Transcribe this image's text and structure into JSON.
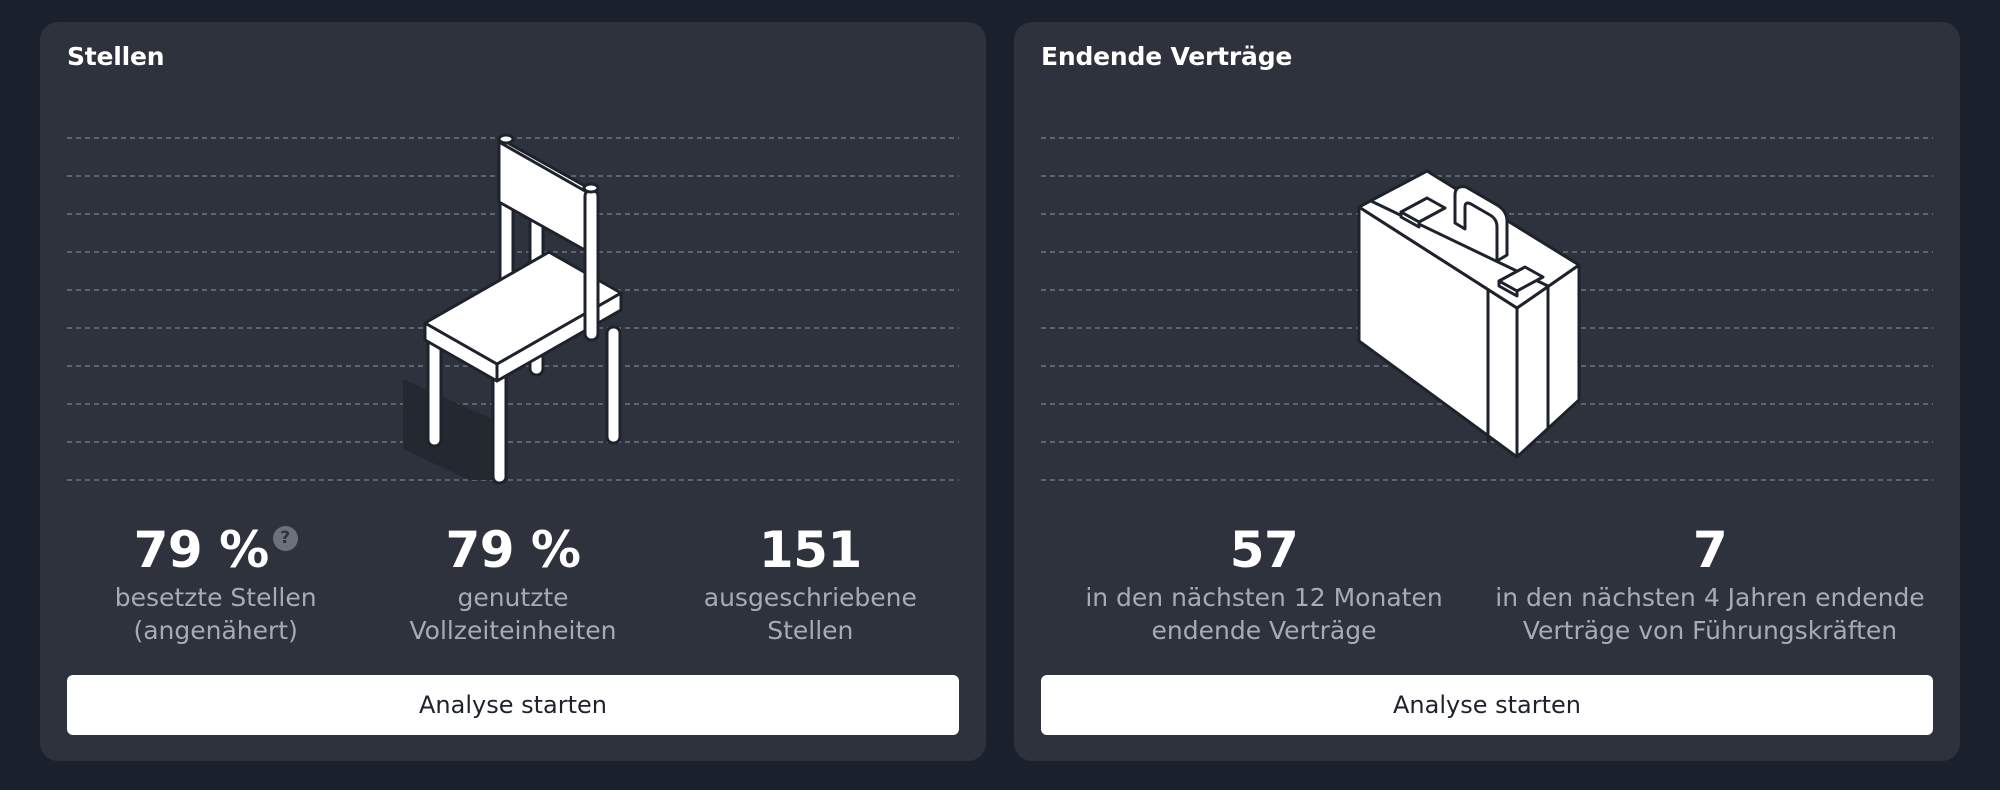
{
  "cards": [
    {
      "title": "Stellen",
      "illustration_icon": "chair-icon",
      "help_icon_glyph": "?",
      "stats": [
        {
          "value": "79 %",
          "label_line1": "besetzte Stellen",
          "label_line2": "(angenähert)"
        },
        {
          "value": "79 %",
          "label_line1": "genutzte",
          "label_line2": "Vollzeiteinheiten"
        },
        {
          "value": "151",
          "label_line1": "ausgeschriebene",
          "label_line2": "Stellen"
        }
      ],
      "button_label": "Analyse starten"
    },
    {
      "title": "Endende Verträge",
      "illustration_icon": "briefcase-icon",
      "stats": [
        {
          "value": "57",
          "label_line1": "in den nächsten 12 Monaten",
          "label_line2": "endende Verträge"
        },
        {
          "value": "7",
          "label_line1": "in den nächsten 4 Jahren endende",
          "label_line2": "Verträge von Führungskräften"
        }
      ],
      "button_label": "Analyse starten"
    }
  ],
  "colors": {
    "page_background": "#1b212c",
    "card_background": "#2d323d",
    "value_text": "#ffffff",
    "label_text": "#a7abb3",
    "button_background": "#ffffff",
    "dashed_lines": "#6f747c"
  }
}
